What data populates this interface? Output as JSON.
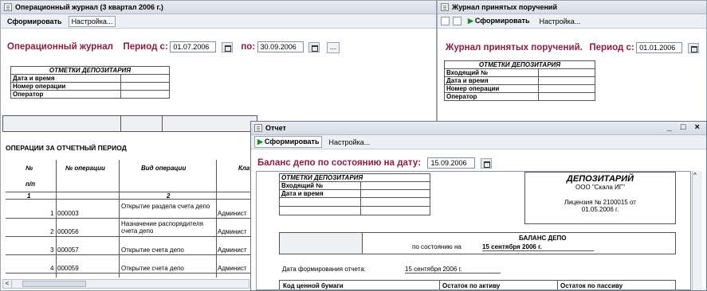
{
  "w1": {
    "title": "Операционный журнал  (3 квартал 2006 г.)",
    "toolbar": {
      "form": "Сформировать",
      "settings": "Настройка..."
    },
    "heading": "Операционный журнал",
    "period_label": "Период с:",
    "date_from": "01.07.2006",
    "to_label": "по:",
    "date_to": "30.09.2006",
    "dots": "...",
    "depo_head": "ОТМЕТКИ ДЕПОЗИТАРИЯ",
    "depo_rows": [
      "Дата и время",
      "Номер операции",
      "Оператор"
    ],
    "ops_title": "ОПЕРАЦИИ ЗА ОТЧЕТНЫЙ ПЕРИОД",
    "cols": {
      "n": "№",
      "pp": "п/п",
      "opnum": "№ операции",
      "type": "Вид операции",
      "cls": "Кла"
    },
    "idx": {
      "n": "1",
      "type": "2"
    },
    "rows": [
      {
        "n": "1",
        "op": "000003",
        "type": "Открытие раздела счета депо",
        "cls": "Админист"
      },
      {
        "n": "2",
        "op": "000056",
        "type": "Назначение распорядителя счета депо",
        "cls": "Админист"
      },
      {
        "n": "3",
        "op": "000057",
        "type": "Открытие счета депо",
        "cls": "Админист"
      },
      {
        "n": "4",
        "op": "000059",
        "type": "Открытие счета депо",
        "cls": "Админист"
      }
    ]
  },
  "w2": {
    "title": "Журнал принятых поручений",
    "toolbar": {
      "form": "Сформировать",
      "settings": "Настройка..."
    },
    "heading": "Журнал принятых поручений.",
    "period_label": "Период с:",
    "date_from": "01.01.2006",
    "depo_head": "ОТМЕТКИ ДЕПОЗИТАРИЯ",
    "depo_rows": [
      "Входящий №",
      "Дата и время",
      "Номер операции",
      "Оператор"
    ]
  },
  "w3": {
    "title": "Отчет",
    "winctrls": "_ □ ×",
    "toolbar": {
      "form": "Сформировать",
      "settings": "Настройка..."
    },
    "heading": "Баланс депо по состоянию на дату:",
    "date": "15.09.2006",
    "depo_head": "ОТМЕТКИ ДЕПОЗИТАРИЯ",
    "depo_rows": [
      "Входящий №",
      "Дата и время"
    ],
    "depositary": {
      "title": "ДЕПОЗИТАРИЙ",
      "name": "ООО \"Скала ИГ\"",
      "license": "Лицензия № 2100015 от",
      "license_date": "01.05.2006 г."
    },
    "balance": {
      "title": "БАЛАНС ДЕПО",
      "as_of_label": "по состоянию на",
      "as_of_value": "15 сентября 2006 г."
    },
    "report_date_label": "Дата формирования отчета:",
    "report_date_value": "15 сентября 2006 г.",
    "bottom_cols": [
      "Код ценной бумаги",
      "Остаток по активу",
      "Остаток по пассиву"
    ]
  }
}
